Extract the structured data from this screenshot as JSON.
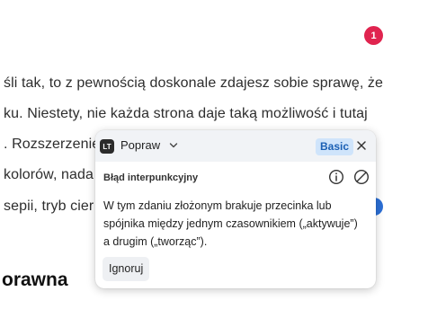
{
  "article": {
    "lines": [
      "śli tak, to z pewnością doskonale zdajesz sobie sprawę, że",
      "ku. Niestety, nie każda strona daje taką możliwość i tutaj",
      ". Rozszerzenie",
      " kolorów, nada",
      " sepii, tryb cier"
    ],
    "heading": "orawna"
  },
  "notification_count": "1",
  "popup": {
    "app_logo": "LT",
    "app_title": "Popraw",
    "plan_badge": "Basic",
    "error_title": "Błąd interpunkcyjny",
    "message": "W tym zdaniu złożonym brakuje przecinka lub spójnika między jednym czasownikiem („aktywuje”) a drugim („tworząc”).",
    "ignore_label": "Ignoruj",
    "icons": [
      "chevron-down-icon",
      "close-icon",
      "info-icon",
      "disable-rule-icon"
    ]
  },
  "colors": {
    "badge": "#e0244f",
    "plan_badge_bg": "#cfe4fb",
    "plan_badge_text": "#1a5fb4",
    "header_bg": "#f1f3f6",
    "blue_marker": "#2b6fd6"
  }
}
